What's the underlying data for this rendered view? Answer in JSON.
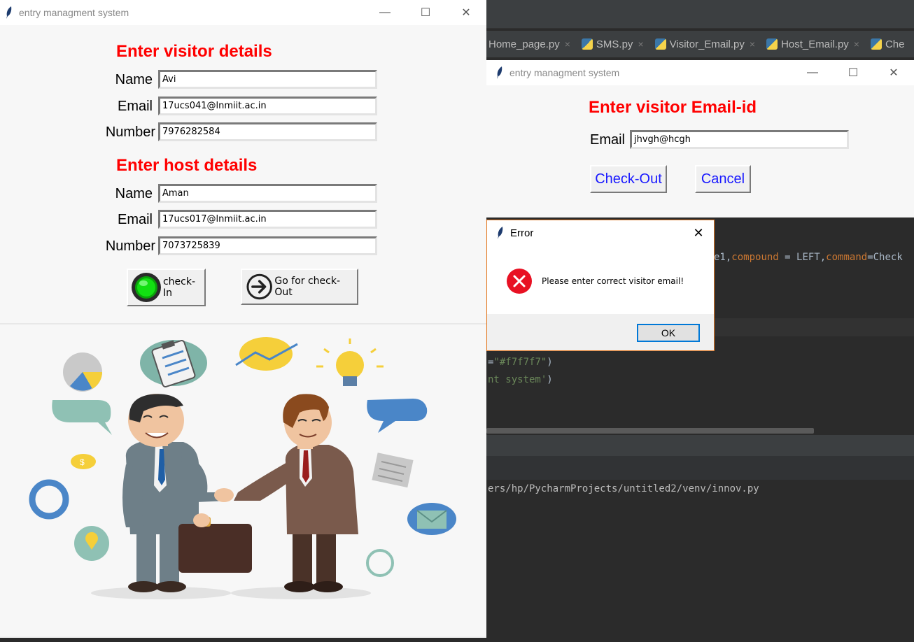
{
  "ide": {
    "tabs": [
      {
        "label": "Home_page.py"
      },
      {
        "label": "SMS.py"
      },
      {
        "label": "Visitor_Email.py"
      },
      {
        "label": "Host_Email.py"
      },
      {
        "label": "Che"
      }
    ],
    "tab_close": "×",
    "code_lines": {
      "line1_a": "e1,",
      "line1_b": "compound",
      "line1_c": " = LEFT,",
      "line1_d": "command",
      "line1_e": "=Check",
      "line2_a": "=",
      "line2_b": "\"#f7f7f7\"",
      "line2_c": ")",
      "line3_a": "nt system'",
      "line3_b": ")",
      "path": "ers/hp/PycharmProjects/untitled2/venv/innov.py"
    }
  },
  "main_window": {
    "title": "entry managment system",
    "visitor_heading": "Enter visitor details",
    "host_heading": "Enter host details",
    "labels": {
      "name": "Name",
      "email": "Email",
      "number": "Number"
    },
    "visitor": {
      "name": "Avi",
      "email": "17ucs041@lnmiit.ac.in",
      "number": "7976282584"
    },
    "host": {
      "name": "Aman",
      "email": "17ucs017@lnmiit.ac.in",
      "number": "7073725839"
    },
    "checkin_label": "check-In",
    "checkout_label": "Go for check-Out"
  },
  "checkout_window": {
    "title": "entry managment system",
    "heading": "Enter visitor Email-id",
    "email_label": "Email",
    "email_value": "jhvgh@hcgh",
    "checkout_button": "Check-Out",
    "cancel_button": "Cancel"
  },
  "error_dialog": {
    "title": "Error",
    "message": "Please enter correct visitor email!",
    "ok": "OK"
  },
  "colors": {
    "heading_red": "#ff0000",
    "button_blue_text": "#1a1aff",
    "error_red": "#e81123",
    "ide_bg": "#2b2b2b"
  }
}
